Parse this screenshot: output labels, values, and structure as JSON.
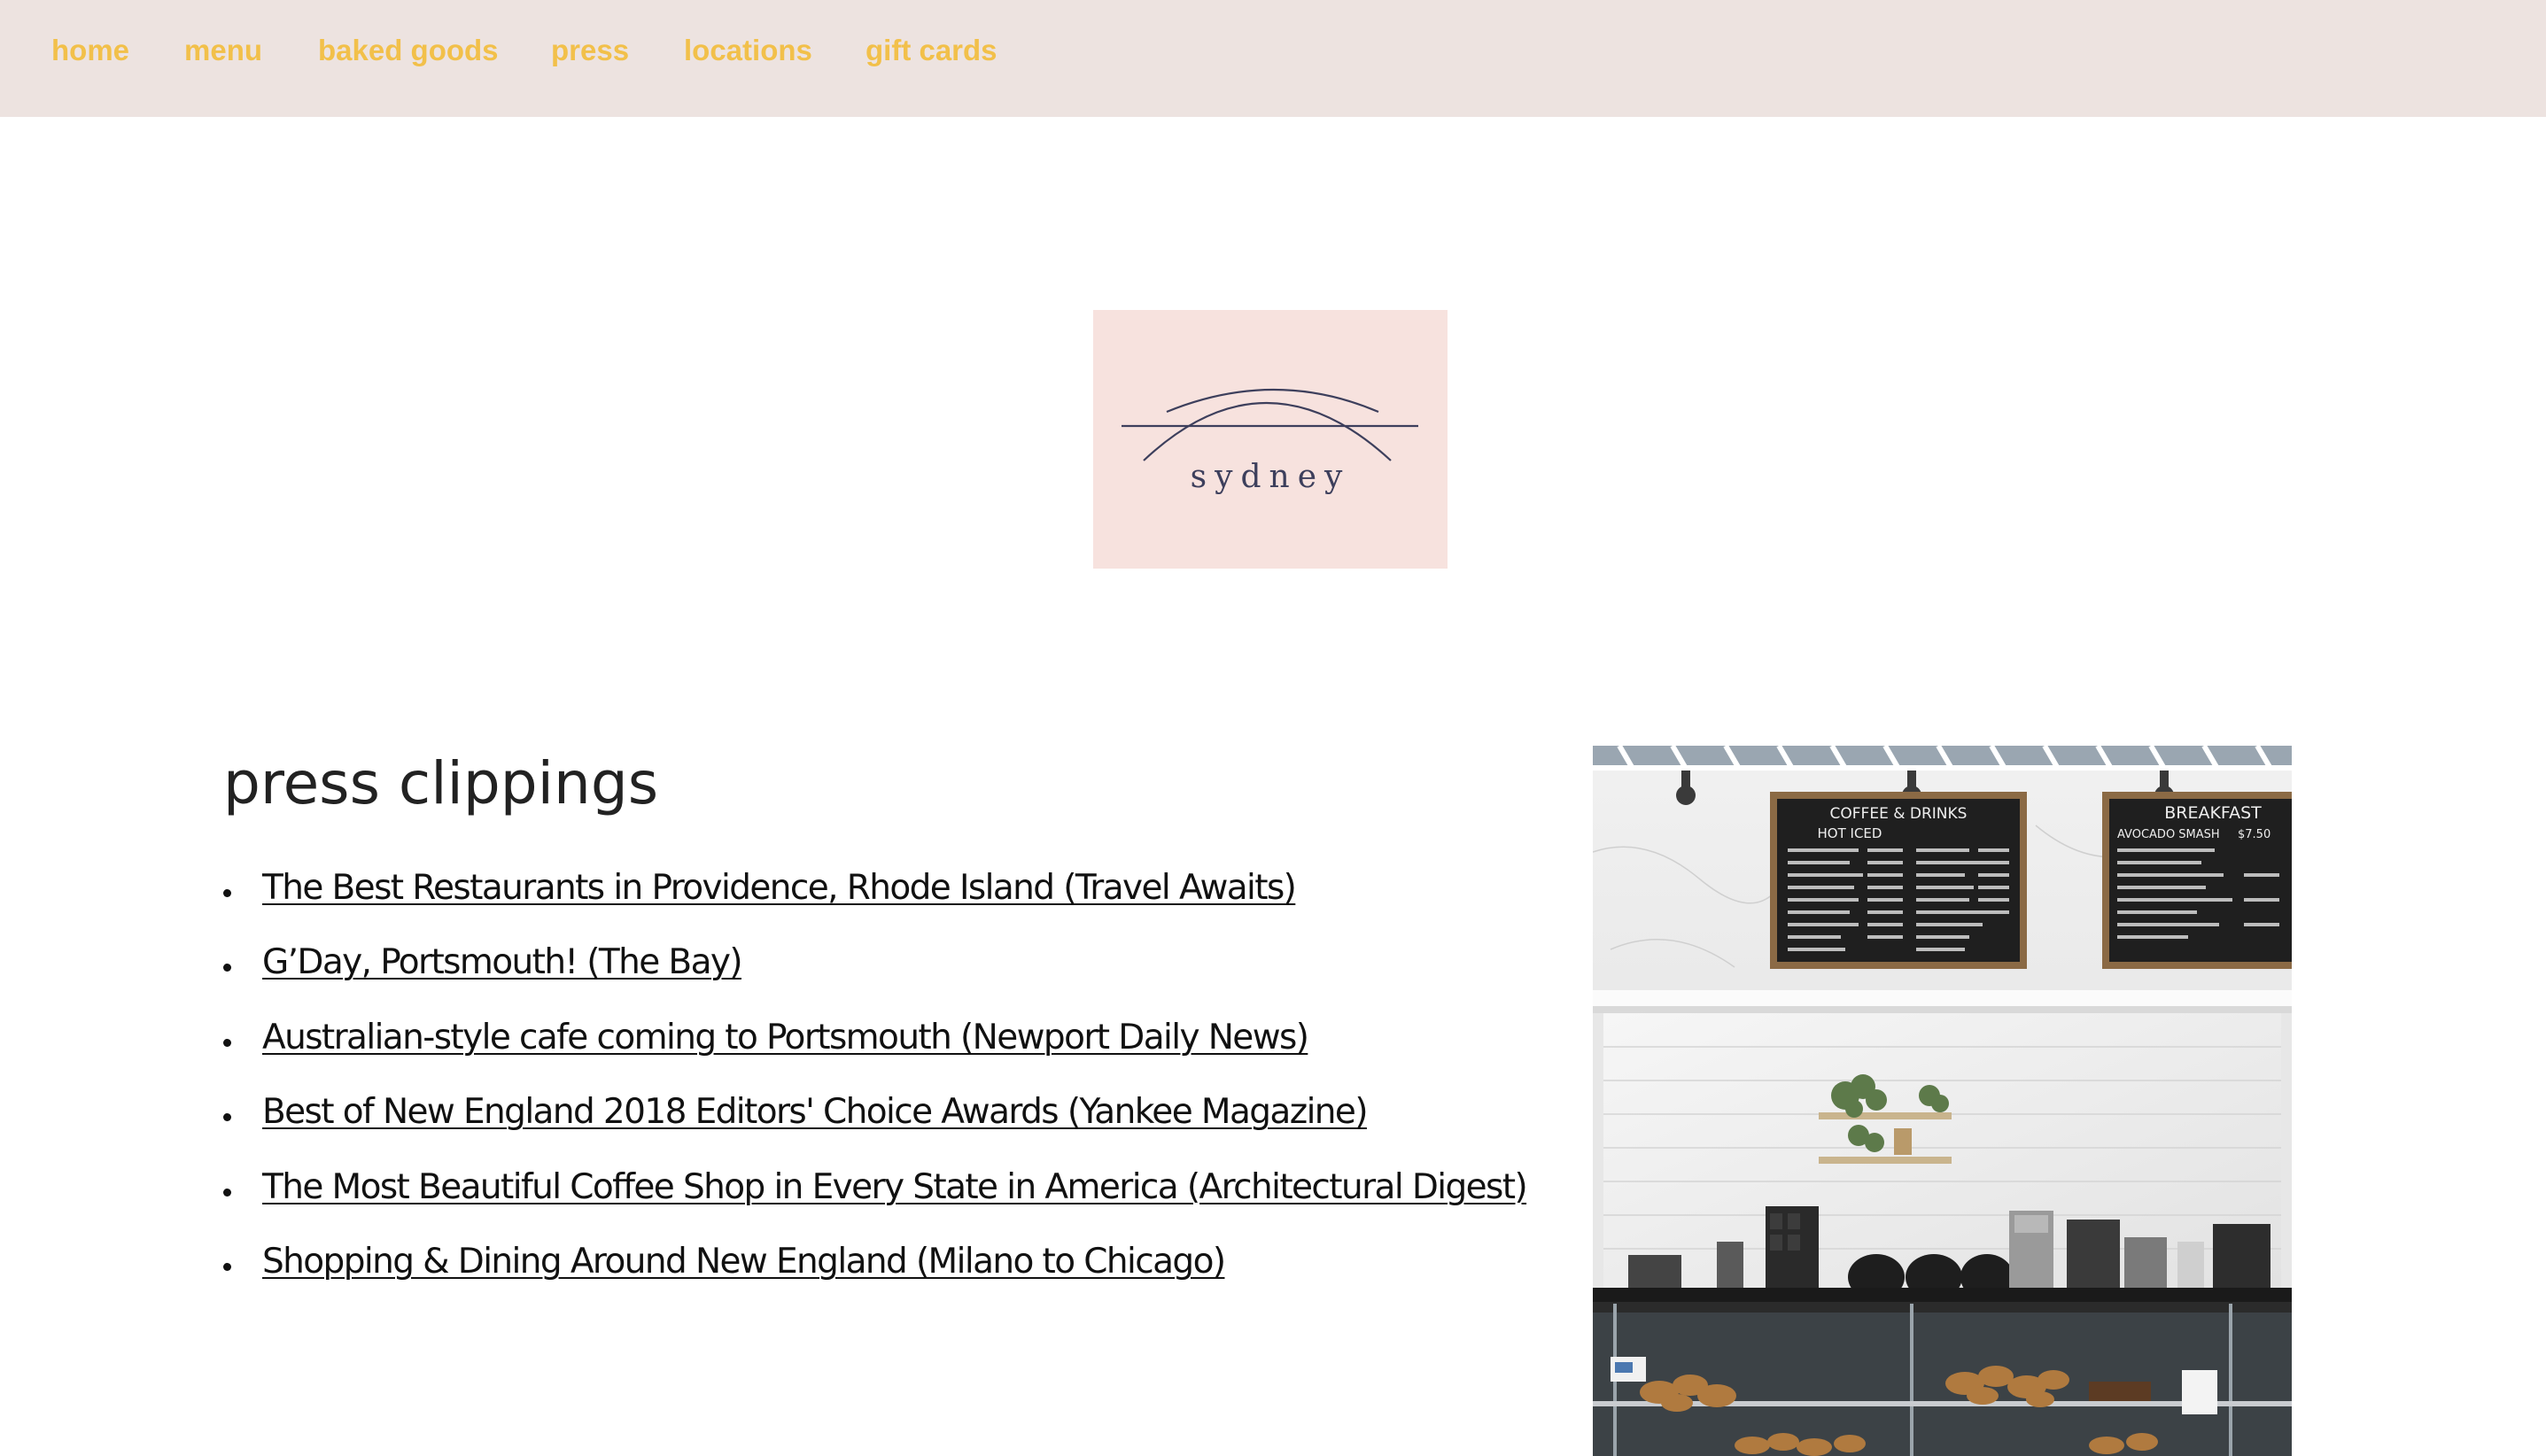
{
  "nav": {
    "items": [
      {
        "label": "home"
      },
      {
        "label": "menu"
      },
      {
        "label": "baked goods"
      },
      {
        "label": "press"
      },
      {
        "label": "locations"
      },
      {
        "label": "gift cards"
      }
    ]
  },
  "logo": {
    "wordmark": "sydney"
  },
  "press": {
    "heading": "press clippings",
    "clippings": [
      {
        "title": "The Best Restaurants in Providence, Rhode Island (Travel Awaits)"
      },
      {
        "title": "G’Day, Portsmouth! (The Bay)"
      },
      {
        "title": "Australian-style cafe coming to Portsmouth (Newport Daily News)"
      },
      {
        "title": "Best of New England 2018 Editors' Choice Awards (Yankee Magazine)"
      },
      {
        "title": "The Most Beautiful Coffee Shop in Every State in America (Architectural Digest)"
      },
      {
        "title": "Shopping & Dining Around New England (Milano to Chicago)"
      }
    ]
  },
  "photo": {
    "menu_board_left_title": "COFFEE & DRINKS",
    "menu_board_left_cols": "HOT ICED",
    "menu_board_right_title": "BREAKFAST",
    "menu_board_right_item": "AVOCADO SMASH",
    "menu_board_right_price": "$7.50"
  },
  "colors": {
    "nav_bg": "#ede3e0",
    "nav_text": "#f2c04a",
    "logo_bg": "#f7e2de",
    "logo_ink": "#3d3f5c",
    "link_text": "#111111"
  }
}
